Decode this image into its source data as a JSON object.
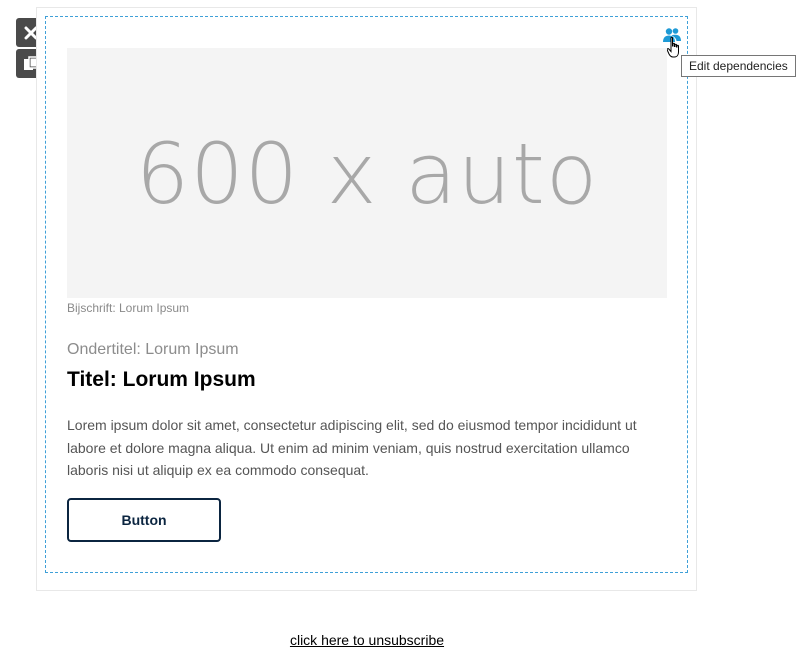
{
  "toolbar": {
    "delete_icon": "close-icon",
    "duplicate_icon": "duplicate-icon"
  },
  "dependencies": {
    "icon": "users-icon",
    "icon_color": "#1e9ad6",
    "tooltip": "Edit dependencies"
  },
  "content": {
    "image_placeholder": "600 x auto",
    "caption": "Bijschrift: Lorum Ipsum",
    "subtitle": "Ondertitel: Lorum Ipsum",
    "title": "Titel: Lorum Ipsum",
    "body": "Lorem ipsum dolor sit amet, consectetur adipiscing elit, sed do eiusmod tempor incididunt ut labore et dolore magna aliqua. Ut enim ad minim veniam, quis nostrud exercitation ullamco laboris nisi ut aliquip ex ea commodo consequat.",
    "button_label": "Button",
    "button_color": "#0b2540"
  },
  "footer": {
    "unsubscribe_link": "click here to unsubscribe"
  },
  "colors": {
    "selection_border": "#3fa0d8",
    "toolbar_bg": "#4a4a4a"
  }
}
